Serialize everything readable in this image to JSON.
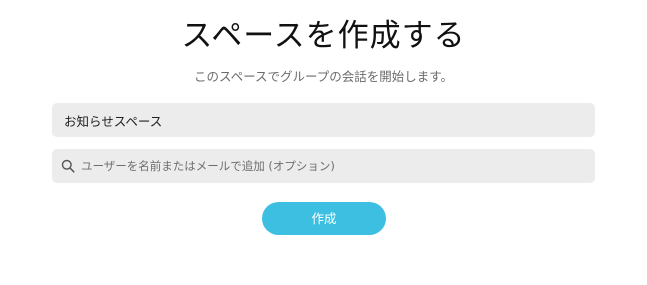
{
  "dialog": {
    "title": "スペースを作成する",
    "subtitle": "このスペースでグループの会話を開始します。"
  },
  "space_name_field": {
    "value": "お知らせスペース"
  },
  "add_members_field": {
    "placeholder": "ユーザーを名前またはメールで追加 (オプション)",
    "icon": "search-icon"
  },
  "create_button": {
    "label": "作成",
    "color": "#3dbfe2"
  }
}
